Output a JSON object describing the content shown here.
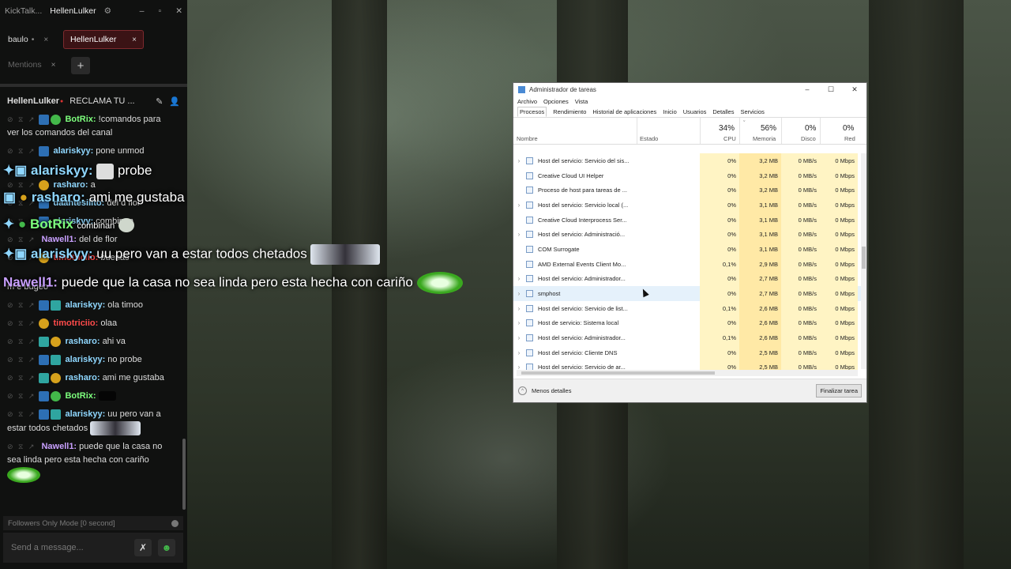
{
  "kicktalk": {
    "app_title": "KickTalk...",
    "window_user": "HellenLulker",
    "tabs": [
      {
        "label": "baulo",
        "close": "×"
      },
      {
        "label": "HellenLulker",
        "close": "×"
      },
      {
        "label": "Mentions",
        "close": "×"
      }
    ],
    "add_tab": "+",
    "chat_channel": "HellenLulker",
    "chat_title": "RECLAMA TU ...",
    "messages": [
      {
        "user": "BotRix:",
        "text": "!comandos para ver los comandos del canal",
        "color": "#7dff7d"
      },
      {
        "user": "alariskyy:",
        "text": "pone unmod",
        "color": "#8fd7ff"
      },
      {
        "user": "rasharo:",
        "text": "a",
        "color": "#8fd7ff"
      },
      {
        "user": "daantesilito:",
        "text": "del d flor",
        "color": "#8fd7ff"
      },
      {
        "user": "alariskyy:",
        "text": "combinan",
        "color": "#8fd7ff"
      },
      {
        "user": "Nawell1:",
        "text": "del de flor",
        "color": "#c9a0ff"
      },
      {
        "user": "timotriciio:",
        "text": "buenas",
        "color": "#ff4b4b"
      },
      {
        "user": "",
        "text": "m e bugeo",
        "color": "#dcdcdc"
      },
      {
        "user": "alariskyy:",
        "text": "ola timoo",
        "color": "#8fd7ff"
      },
      {
        "user": "timotriciio:",
        "text": "olaa",
        "color": "#ff4b4b"
      },
      {
        "user": "rasharo:",
        "text": "ahi va",
        "color": "#8fd7ff"
      },
      {
        "user": "alariskyy:",
        "text": "no probe",
        "color": "#8fd7ff"
      },
      {
        "user": "rasharo:",
        "text": "ami me gustaba",
        "color": "#8fd7ff"
      },
      {
        "user": "BotRix:",
        "text": "",
        "color": "#7dff7d"
      },
      {
        "user": "alariskyy:",
        "text": "uu pero van a estar todos chetados",
        "color": "#8fd7ff"
      },
      {
        "user": "Nawell1:",
        "text": "puede que la casa no sea linda pero esta hecha con cariño",
        "color": "#c9a0ff"
      }
    ],
    "followers_mode": "Followers Only Mode [0 second]",
    "send_placeholder": "Send a message..."
  },
  "overlay": [
    {
      "user": "alariskyy:",
      "text": "probe",
      "color": "#8fd7ff"
    },
    {
      "user": "rasharo:",
      "text": "ami me gustaba",
      "color": "#8fd7ff"
    },
    {
      "user": "BotRix",
      "text": "combinan",
      "color": "#7dff7d"
    },
    {
      "user": "alariskyy:",
      "text": "uu pero van a estar todos chetados",
      "color": "#8fd7ff"
    },
    {
      "user": "Nawell1:",
      "text": "puede que la casa no sea linda pero esta hecha con cariño",
      "color": "#c9a0ff"
    }
  ],
  "taskmgr": {
    "title": "Administrador de tareas",
    "menu": [
      "Archivo",
      "Opciones",
      "Vista"
    ],
    "tabs": [
      "Procesos",
      "Rendimiento",
      "Historial de aplicaciones",
      "Inicio",
      "Usuarios",
      "Detalles",
      "Servicios"
    ],
    "columns": {
      "name": "Nombre",
      "status": "Estado",
      "cpu_pct": "34%",
      "cpu": "CPU",
      "mem_pct": "56%",
      "mem": "Memoria",
      "disk_pct": "0%",
      "disk": "Disco",
      "net_pct": "0%",
      "net": "Red"
    },
    "rows": [
      {
        "name": "Host del servicio: Servicio del sis...",
        "cpu": "0%",
        "mem": "3,2 MB",
        "disk": "0 MB/s",
        "net": "0 Mbps",
        "exp": true
      },
      {
        "name": "Creative Cloud UI Helper",
        "cpu": "0%",
        "mem": "3,2 MB",
        "disk": "0 MB/s",
        "net": "0 Mbps",
        "exp": false
      },
      {
        "name": "Proceso de host para tareas de ...",
        "cpu": "0%",
        "mem": "3,2 MB",
        "disk": "0 MB/s",
        "net": "0 Mbps",
        "exp": false
      },
      {
        "name": "Host del servicio: Servicio local (...",
        "cpu": "0%",
        "mem": "3,1 MB",
        "disk": "0 MB/s",
        "net": "0 Mbps",
        "exp": true
      },
      {
        "name": "Creative Cloud Interprocess Ser...",
        "cpu": "0%",
        "mem": "3,1 MB",
        "disk": "0 MB/s",
        "net": "0 Mbps",
        "exp": false
      },
      {
        "name": "Host del servicio: Administració...",
        "cpu": "0%",
        "mem": "3,1 MB",
        "disk": "0 MB/s",
        "net": "0 Mbps",
        "exp": true
      },
      {
        "name": "COM Surrogate",
        "cpu": "0%",
        "mem": "3,1 MB",
        "disk": "0 MB/s",
        "net": "0 Mbps",
        "exp": false
      },
      {
        "name": "AMD External Events Client Mo...",
        "cpu": "0,1%",
        "mem": "2,9 MB",
        "disk": "0 MB/s",
        "net": "0 Mbps",
        "exp": false
      },
      {
        "name": "Host del servicio: Administrador...",
        "cpu": "0%",
        "mem": "2,7 MB",
        "disk": "0 MB/s",
        "net": "0 Mbps",
        "exp": true
      },
      {
        "name": "smphost",
        "cpu": "0%",
        "mem": "2,7 MB",
        "disk": "0 MB/s",
        "net": "0 Mbps",
        "exp": true
      },
      {
        "name": "Host del servicio: Servicio de list...",
        "cpu": "0,1%",
        "mem": "2,6 MB",
        "disk": "0 MB/s",
        "net": "0 Mbps",
        "exp": true
      },
      {
        "name": "Host de servicio: Sistema local",
        "cpu": "0%",
        "mem": "2,6 MB",
        "disk": "0 MB/s",
        "net": "0 Mbps",
        "exp": true
      },
      {
        "name": "Host del servicio: Administrador...",
        "cpu": "0,1%",
        "mem": "2,6 MB",
        "disk": "0 MB/s",
        "net": "0 Mbps",
        "exp": true
      },
      {
        "name": "Host del servicio: Cliente DNS",
        "cpu": "0%",
        "mem": "2,5 MB",
        "disk": "0 MB/s",
        "net": "0 Mbps",
        "exp": true
      },
      {
        "name": "Host del servicio: Servicio de ar...",
        "cpu": "0%",
        "mem": "2,5 MB",
        "disk": "0 MB/s",
        "net": "0 Mbps",
        "exp": true
      }
    ],
    "less_details": "Menos detalles",
    "end_task": "Finalizar tarea"
  }
}
